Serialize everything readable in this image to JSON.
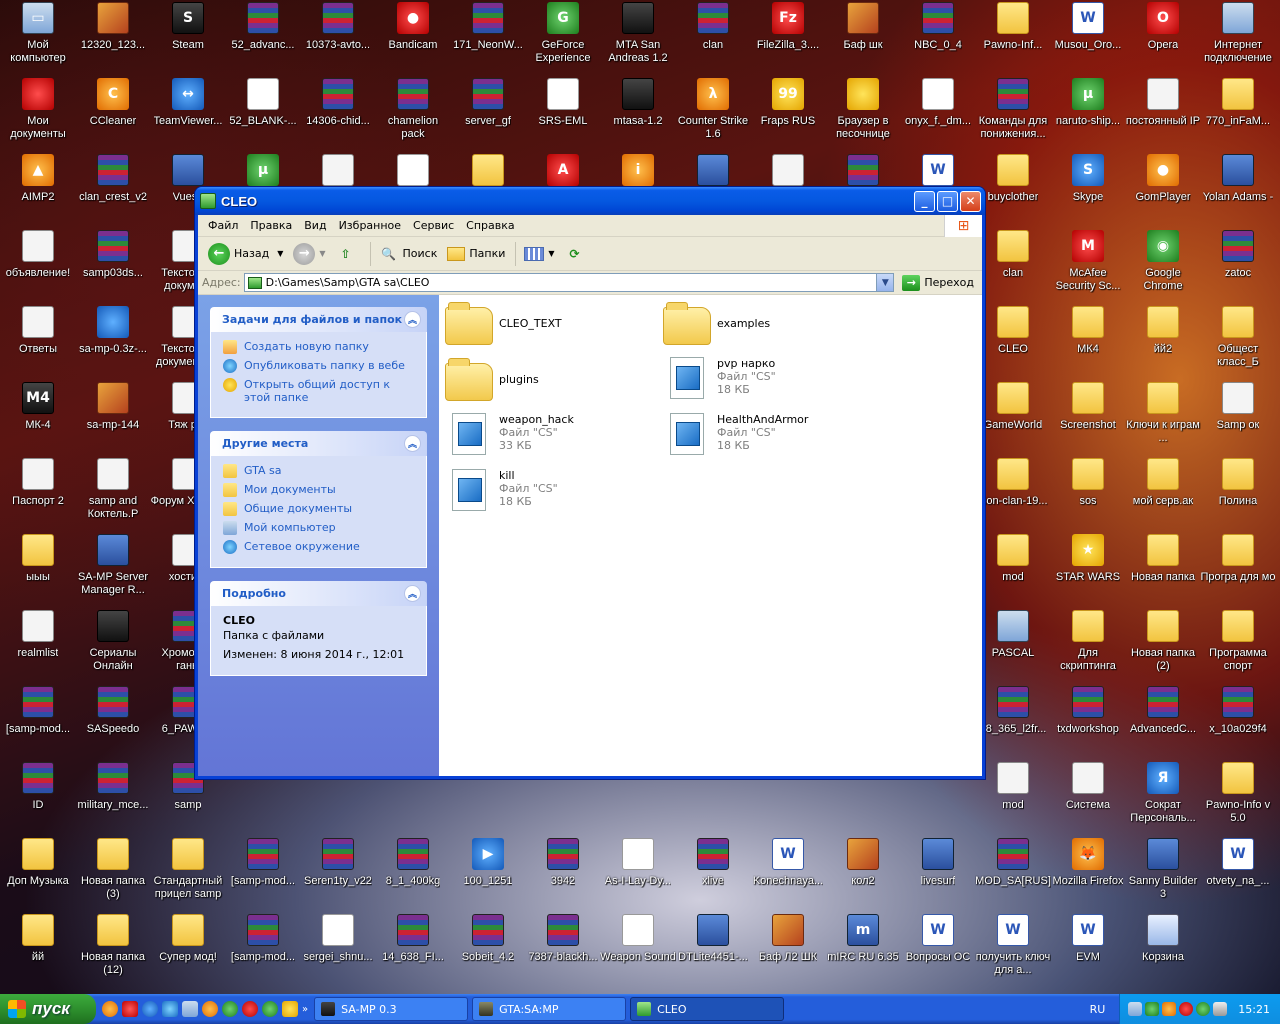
{
  "desktop": {
    "icons": [
      {
        "label": "Мой компьютер",
        "kind": "pc",
        "glyph": "▭"
      },
      {
        "label": "12320_123...",
        "kind": "img",
        "glyph": ""
      },
      {
        "label": "Steam",
        "kind": "dark",
        "glyph": "S"
      },
      {
        "label": "52_advanc...",
        "kind": "rar",
        "glyph": ""
      },
      {
        "label": "10373-avto...",
        "kind": "rar",
        "glyph": ""
      },
      {
        "label": "Bandicam",
        "kind": "red",
        "glyph": "●"
      },
      {
        "label": "171_NeonW...",
        "kind": "rar",
        "glyph": ""
      },
      {
        "label": "GeForce Experience",
        "kind": "green",
        "glyph": "G"
      },
      {
        "label": "MTA San Andreas 1.2",
        "kind": "dark",
        "glyph": ""
      },
      {
        "label": "clan",
        "kind": "rar",
        "glyph": ""
      },
      {
        "label": "FileZilla_3....",
        "kind": "red",
        "glyph": "Fz"
      },
      {
        "label": "Баф шк",
        "kind": "img",
        "glyph": ""
      },
      {
        "label": "NBC_0_4",
        "kind": "rar",
        "glyph": ""
      },
      {
        "label": "Pawno-Inf...",
        "kind": "folder",
        "glyph": ""
      },
      {
        "label": "Musou_Oro...",
        "kind": "word",
        "glyph": "W"
      },
      {
        "label": "Opera",
        "kind": "red",
        "glyph": "O"
      },
      {
        "label": "Интернет подключение",
        "kind": "pc",
        "glyph": ""
      },
      {
        "label": "Мои документы",
        "kind": "red",
        "glyph": ""
      },
      {
        "label": "CCleaner",
        "kind": "orange",
        "glyph": "C"
      },
      {
        "label": "TeamViewer...",
        "kind": "blue",
        "glyph": "↔"
      },
      {
        "label": "52_BLANK-...",
        "kind": "doc",
        "glyph": ""
      },
      {
        "label": "14306-chid...",
        "kind": "rar",
        "glyph": ""
      },
      {
        "label": "chamelion pack",
        "kind": "rar",
        "glyph": ""
      },
      {
        "label": "server_gf",
        "kind": "rar",
        "glyph": ""
      },
      {
        "label": "SRS-EML",
        "kind": "doc",
        "glyph": ""
      },
      {
        "label": "mtasa-1.2",
        "kind": "dark",
        "glyph": ""
      },
      {
        "label": "Counter Strike 1.6",
        "kind": "orange",
        "glyph": "λ"
      },
      {
        "label": "Fraps RUS",
        "kind": "yellow",
        "glyph": "99"
      },
      {
        "label": "Браузер в песочнице",
        "kind": "yellow",
        "glyph": ""
      },
      {
        "label": "onyx_f._dm...",
        "kind": "doc",
        "glyph": ""
      },
      {
        "label": "Команды для понижения...",
        "kind": "rar",
        "glyph": ""
      },
      {
        "label": "naruto-ship...",
        "kind": "green",
        "glyph": "µ"
      },
      {
        "label": "постоянный IP",
        "kind": "txt",
        "glyph": ""
      },
      {
        "label": "770_inFaM...",
        "kind": "folder",
        "glyph": ""
      },
      {
        "label": "AIMP2",
        "kind": "orange",
        "glyph": "▲"
      },
      {
        "label": "clan_crest_v2",
        "kind": "rar",
        "glyph": ""
      },
      {
        "label": "Vueso",
        "kind": "exe",
        "glyph": ""
      },
      {
        "label": "µTorrent",
        "kind": "green",
        "glyph": "µ"
      },
      {
        "label": "samp",
        "kind": "txt",
        "glyph": ""
      },
      {
        "label": "Список вещей и...",
        "kind": "doc",
        "glyph": "X"
      },
      {
        "label": "AIM для steam cs 1.6",
        "kind": "folder",
        "glyph": ""
      },
      {
        "label": "Alcohol 120%",
        "kind": "red",
        "glyph": "A"
      },
      {
        "label": "EVEREST Ultima...",
        "kind": "orange",
        "glyph": "i"
      },
      {
        "label": "Wina",
        "kind": "exe",
        "glyph": ""
      },
      {
        "label": "Настройки маршрутиз...",
        "kind": "txt",
        "glyph": ""
      },
      {
        "label": "samp03dsvr...",
        "kind": "rar",
        "glyph": ""
      },
      {
        "label": "CPC",
        "kind": "word",
        "glyph": "W"
      },
      {
        "label": "buyclother",
        "kind": "folder",
        "glyph": ""
      },
      {
        "label": "Skype",
        "kind": "blue",
        "glyph": "S"
      },
      {
        "label": "GomPlayer",
        "kind": "orange",
        "glyph": "●"
      },
      {
        "label": "Yolan Adams -",
        "kind": "exe",
        "glyph": ""
      },
      {
        "label": "объявление!",
        "kind": "txt",
        "glyph": ""
      },
      {
        "label": "samp03ds...",
        "kind": "rar",
        "glyph": ""
      },
      {
        "label": "Текстовый документ",
        "kind": "txt",
        "glyph": ""
      },
      {
        "label": "clan",
        "kind": "folder",
        "glyph": ""
      },
      {
        "label": "McAfee Security Sc...",
        "kind": "red",
        "glyph": "M"
      },
      {
        "label": "Google Chrome",
        "kind": "green",
        "glyph": "◉"
      },
      {
        "label": "zatoc",
        "kind": "rar",
        "glyph": ""
      },
      {
        "label": "Ответы",
        "kind": "txt",
        "glyph": ""
      },
      {
        "label": "sa-mp-0.3z-...",
        "kind": "blue",
        "glyph": ""
      },
      {
        "label": "Текстовый документ (2)",
        "kind": "txt",
        "glyph": ""
      },
      {
        "label": "CLEO",
        "kind": "folder",
        "glyph": ""
      },
      {
        "label": "МК4",
        "kind": "folder",
        "glyph": ""
      },
      {
        "label": "йй2",
        "kind": "folder",
        "glyph": ""
      },
      {
        "label": "Общест класс_Б",
        "kind": "folder",
        "glyph": ""
      },
      {
        "label": "МК-4",
        "kind": "dark",
        "glyph": "M4"
      },
      {
        "label": "sa-mp-144",
        "kind": "img",
        "glyph": ""
      },
      {
        "label": "Тяж рок",
        "kind": "txt",
        "glyph": ""
      },
      {
        "label": "GameWorld",
        "kind": "folder",
        "glyph": ""
      },
      {
        "label": "Screenshot",
        "kind": "folder",
        "glyph": ""
      },
      {
        "label": "Ключи к играм ...",
        "kind": "folder",
        "glyph": ""
      },
      {
        "label": "Samp ок",
        "kind": "txt",
        "glyph": ""
      },
      {
        "label": "Паспорт 2",
        "kind": "txt",
        "glyph": ""
      },
      {
        "label": "samp and Коктель.Р",
        "kind": "txt",
        "glyph": ""
      },
      {
        "label": "Форум Хитман",
        "kind": "txt",
        "glyph": ""
      },
      {
        "label": "icon-clan-19...",
        "kind": "folder",
        "glyph": ""
      },
      {
        "label": "sos",
        "kind": "folder",
        "glyph": ""
      },
      {
        "label": "мой серв.ак",
        "kind": "folder",
        "glyph": ""
      },
      {
        "label": "Полина",
        "kind": "folder",
        "glyph": ""
      },
      {
        "label": "ыыы",
        "kind": "folder",
        "glyph": ""
      },
      {
        "label": "SA-MP Server Manager R...",
        "kind": "exe",
        "glyph": ""
      },
      {
        "label": "хостинг",
        "kind": "txt",
        "glyph": ""
      },
      {
        "label": "mod",
        "kind": "folder",
        "glyph": ""
      },
      {
        "label": "STAR WARS",
        "kind": "yellow",
        "glyph": "★"
      },
      {
        "label": "Новая папка",
        "kind": "folder",
        "glyph": ""
      },
      {
        "label": "Програ для мо",
        "kind": "folder",
        "glyph": ""
      },
      {
        "label": "realmlist",
        "kind": "txt",
        "glyph": ""
      },
      {
        "label": "Сериалы Онлайн",
        "kind": "dark",
        "glyph": ""
      },
      {
        "label": "Хромовые ганы",
        "kind": "rar",
        "glyph": ""
      },
      {
        "label": "PASCAL",
        "kind": "pc",
        "glyph": ""
      },
      {
        "label": "Для скриптинга",
        "kind": "folder",
        "glyph": ""
      },
      {
        "label": "Новая папка (2)",
        "kind": "folder",
        "glyph": ""
      },
      {
        "label": "Программа спорт",
        "kind": "folder",
        "glyph": ""
      },
      {
        "label": "[samp-mod...",
        "kind": "rar",
        "glyph": ""
      },
      {
        "label": "SASpeedo",
        "kind": "rar",
        "glyph": ""
      },
      {
        "label": "6_PAWNO",
        "kind": "rar",
        "glyph": ""
      },
      {
        "label": "58_365_l2fr...",
        "kind": "rar",
        "glyph": ""
      },
      {
        "label": "txdworkshop",
        "kind": "rar",
        "glyph": ""
      },
      {
        "label": "AdvancedC...",
        "kind": "rar",
        "glyph": ""
      },
      {
        "label": "x_10a029f4",
        "kind": "rar",
        "glyph": ""
      },
      {
        "label": "ID",
        "kind": "rar",
        "glyph": ""
      },
      {
        "label": "military_mce...",
        "kind": "rar",
        "glyph": ""
      },
      {
        "label": "samp",
        "kind": "rar",
        "glyph": ""
      },
      {
        "label": "mod",
        "kind": "txt",
        "glyph": ""
      },
      {
        "label": "Система",
        "kind": "txt",
        "glyph": ""
      },
      {
        "label": "Сократ Персональ...",
        "kind": "blue",
        "glyph": "Я"
      },
      {
        "label": "Pawno-Info v 5.0",
        "kind": "folder",
        "glyph": ""
      },
      {
        "label": "Доп Музыка",
        "kind": "folder",
        "glyph": ""
      },
      {
        "label": "Новая папка (3)",
        "kind": "folder",
        "glyph": ""
      },
      {
        "label": "Стандартный прицел samp",
        "kind": "folder",
        "glyph": ""
      },
      {
        "label": "[samp-mod...",
        "kind": "rar",
        "glyph": ""
      },
      {
        "label": "Seren1ty_v22",
        "kind": "rar",
        "glyph": ""
      },
      {
        "label": "8_1_400kg",
        "kind": "rar",
        "glyph": ""
      },
      {
        "label": "100_1251",
        "kind": "blue",
        "glyph": "▶"
      },
      {
        "label": "3942",
        "kind": "rar",
        "glyph": ""
      },
      {
        "label": "As-I-Lay-Dy...",
        "kind": "doc",
        "glyph": ""
      },
      {
        "label": "xlive",
        "kind": "rar",
        "glyph": ""
      },
      {
        "label": "Konechnaya...",
        "kind": "word",
        "glyph": "W"
      },
      {
        "label": "кол2",
        "kind": "img",
        "glyph": ""
      },
      {
        "label": "livesurf",
        "kind": "exe",
        "glyph": ""
      },
      {
        "label": "MOD_SA[RUS]",
        "kind": "rar",
        "glyph": ""
      },
      {
        "label": "Mozilla Firefox",
        "kind": "orange",
        "glyph": "🦊"
      },
      {
        "label": "Sanny Builder 3",
        "kind": "exe",
        "glyph": ""
      },
      {
        "label": "otvety_na_...",
        "kind": "word",
        "glyph": "W"
      },
      {
        "label": "йй",
        "kind": "folder",
        "glyph": ""
      },
      {
        "label": "Новая папка (12)",
        "kind": "folder",
        "glyph": ""
      },
      {
        "label": "Супер мод!",
        "kind": "folder",
        "glyph": ""
      },
      {
        "label": "[samp-mod...",
        "kind": "rar",
        "glyph": ""
      },
      {
        "label": "sergei_shnu...",
        "kind": "doc",
        "glyph": ""
      },
      {
        "label": "14_638_FI...",
        "kind": "rar",
        "glyph": ""
      },
      {
        "label": "Sobeit_4.2",
        "kind": "rar",
        "glyph": ""
      },
      {
        "label": "7387-blackh...",
        "kind": "rar",
        "glyph": ""
      },
      {
        "label": "Weapon Sound",
        "kind": "doc",
        "glyph": ""
      },
      {
        "label": "DTLite4451-...",
        "kind": "exe",
        "glyph": ""
      },
      {
        "label": "Баф Л2 ШК",
        "kind": "img",
        "glyph": ""
      },
      {
        "label": "mIRC RU 6.35",
        "kind": "exe",
        "glyph": "m"
      },
      {
        "label": "Вопросы ОС",
        "kind": "word",
        "glyph": "W"
      },
      {
        "label": "получить ключ для а...",
        "kind": "word",
        "glyph": "W"
      },
      {
        "label": "EVM",
        "kind": "word",
        "glyph": "W"
      },
      {
        "label": "Корзина",
        "kind": "bin",
        "glyph": ""
      }
    ]
  },
  "window": {
    "title": "CLEO",
    "menu": [
      "Файл",
      "Правка",
      "Вид",
      "Избранное",
      "Сервис",
      "Справка"
    ],
    "toolbar": {
      "back": "Назад",
      "search": "Поиск",
      "folders": "Папки"
    },
    "address": {
      "label": "Адрес:",
      "path": "D:\\Games\\Samp\\GTA sa\\CLEO",
      "go": "Переход"
    },
    "tasks": {
      "file_tasks": {
        "title": "Задачи для файлов и папок",
        "links": [
          "Создать новую папку",
          "Опубликовать папку в вебе",
          "Открыть общий доступ к этой папке"
        ]
      },
      "other_places": {
        "title": "Другие места",
        "links": [
          "GTA sa",
          "Мои документы",
          "Общие документы",
          "Мой компьютер",
          "Сетевое окружение"
        ]
      },
      "details": {
        "title": "Подробно",
        "name": "CLEO",
        "type": "Папка с файлами",
        "modified": "Изменен: 8 июня 2014 г., 12:01"
      }
    },
    "files": [
      {
        "name": "CLEO_TEXT",
        "type": "",
        "size": "",
        "kind": "folder"
      },
      {
        "name": "examples",
        "type": "",
        "size": "",
        "kind": "folder"
      },
      {
        "name": "plugins",
        "type": "",
        "size": "",
        "kind": "folder"
      },
      {
        "name": "pvp нарко",
        "type": "Файл \"CS\"",
        "size": "18 КБ",
        "kind": "cs"
      },
      {
        "name": "weapon_hack",
        "type": "Файл \"CS\"",
        "size": "33 КБ",
        "kind": "cs"
      },
      {
        "name": "HealthAndArmor",
        "type": "Файл \"CS\"",
        "size": "18 КБ",
        "kind": "cs"
      },
      {
        "name": "kill",
        "type": "Файл \"CS\"",
        "size": "18 КБ",
        "kind": "cs"
      }
    ]
  },
  "taskbar": {
    "start": "пуск",
    "tasks": [
      {
        "label": "SA-MP 0.3",
        "active": false
      },
      {
        "label": "GTA:SA:MP",
        "active": false
      },
      {
        "label": "CLEO",
        "active": true
      }
    ],
    "lang": "RU",
    "clock": "15:21"
  }
}
